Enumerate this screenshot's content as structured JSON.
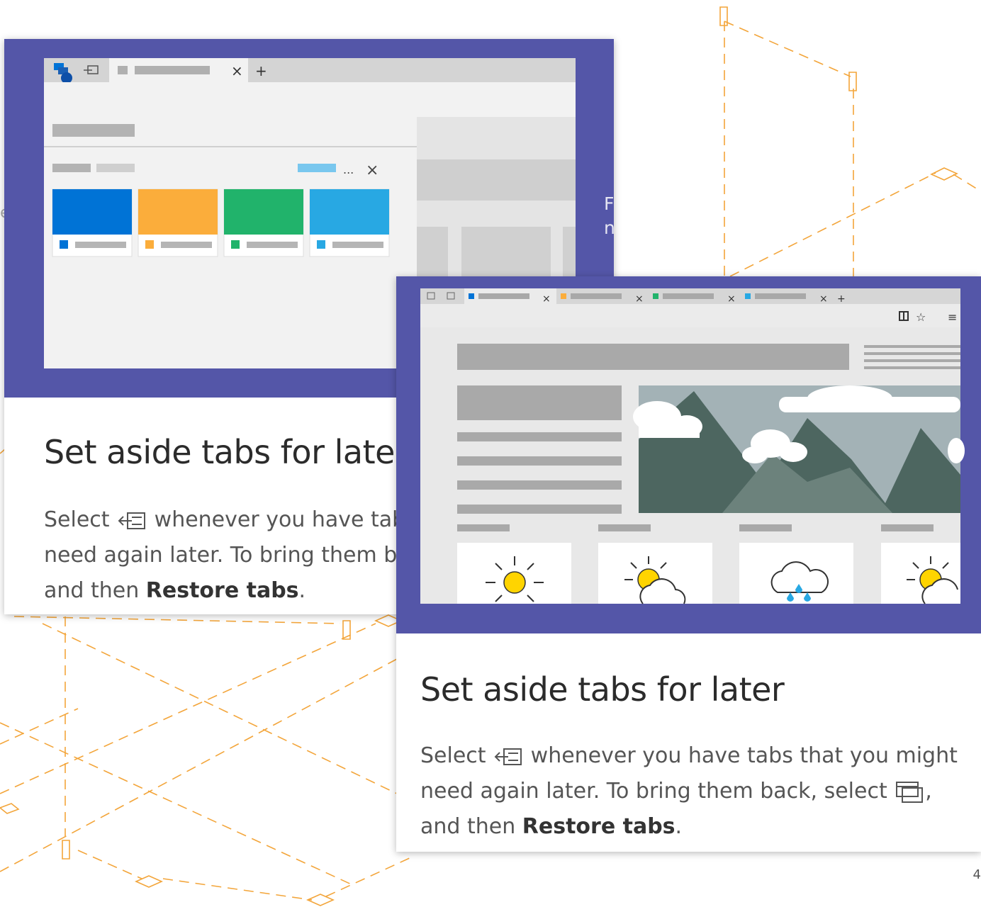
{
  "slides": [
    {
      "title": "Set aside tabs for later",
      "body_select": "Select",
      "body_after_icon": "whenever you have tabs that you might need again later. To bring them back, select",
      "body_and_then": ", and then",
      "body_bold": "Restore tabs",
      "body_end": "."
    },
    {
      "title": "Set aside tabs for later",
      "body_select": "Select",
      "body_after_icon": "whenever you have tabs that you might need again later. To bring them back, select",
      "body_and_then": ", and then",
      "body_bold": "Restore tabs",
      "body_end": "."
    }
  ],
  "side_fragments": [
    "F",
    "n"
  ],
  "page_number": "4",
  "icons": [
    "set-aside-tabs-icon",
    "tabs-set-aside-icon",
    "close-icon",
    "new-tab-icon",
    "reading-view-icon",
    "favorite-star-icon",
    "hub-icon",
    "sun-icon",
    "partly-cloudy-icon",
    "rain-icon",
    "mountain-icon"
  ],
  "colors": {
    "hero": "#5456a8",
    "tile_blue": "#0073d6",
    "tile_orange": "#fbad3b",
    "tile_green": "#21b36b",
    "tile_cyan": "#28a8e3",
    "orange_line": "#f3a53a",
    "mountain_dark": "#4d6660",
    "sky": "#a3b2b6"
  }
}
